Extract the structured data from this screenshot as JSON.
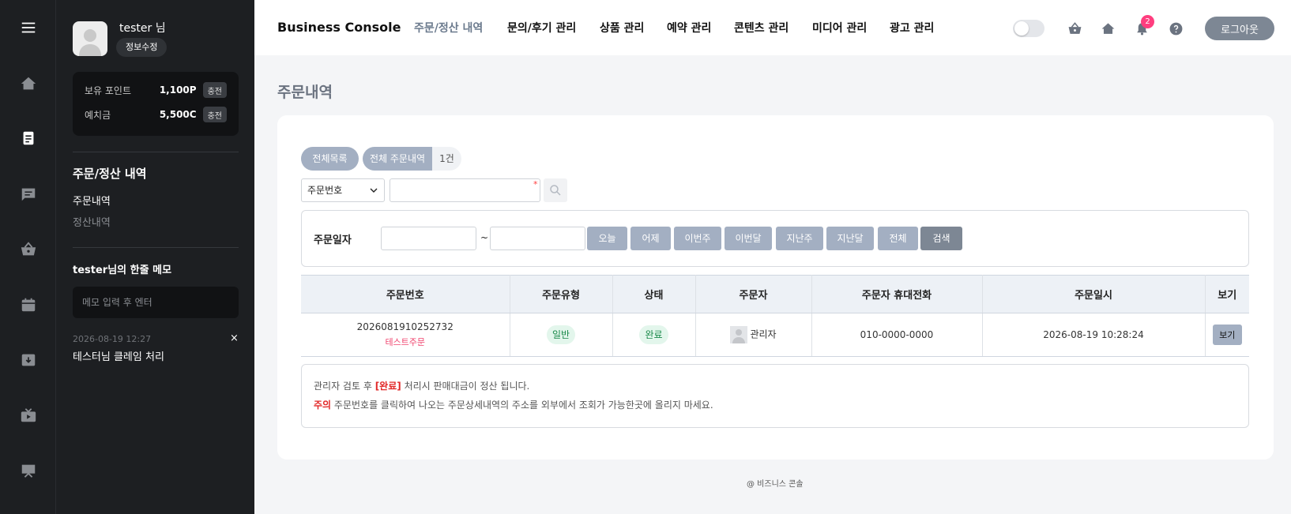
{
  "rail": {
    "items": [
      "menu-icon",
      "home-icon",
      "document-icon",
      "chat-icon",
      "basket-icon",
      "calendar-icon",
      "archive-icon",
      "tv-icon",
      "board-icon"
    ]
  },
  "profile": {
    "name": "tester 님",
    "edit_label": "정보수정"
  },
  "wallet": {
    "points_label": "보유 포인트",
    "points_value": "1,100P",
    "deposit_label": "예치금",
    "deposit_value": "5,500C",
    "charge_label": "충전"
  },
  "side_menu": {
    "title": "주문/정산 내역",
    "items": [
      {
        "label": "주문내역",
        "active": true
      },
      {
        "label": "정산내역",
        "active": false
      }
    ]
  },
  "memo": {
    "title": "tester님의 한줄 메모",
    "placeholder": "메모 입력 후 엔터",
    "entries": [
      {
        "date": "2026-08-19 12:27",
        "text": "테스터님 클레임 처리",
        "close": "×"
      }
    ]
  },
  "header": {
    "brand": "Business Console",
    "nav": [
      {
        "label": "주문/정산 내역",
        "active": true
      },
      {
        "label": "문의/후기 관리",
        "active": false
      },
      {
        "label": "상품 관리",
        "active": false
      },
      {
        "label": "예약 관리",
        "active": false
      },
      {
        "label": "콘텐츠 관리",
        "active": false
      },
      {
        "label": "미디어 관리",
        "active": false
      },
      {
        "label": "광고 관리",
        "active": false
      }
    ],
    "notification_count": "2",
    "logout_label": "로그아웃"
  },
  "page": {
    "title": "주문내역",
    "tabs": {
      "all_list": "전체목록",
      "all_orders": "전체 주문내역",
      "count": "1건"
    },
    "search": {
      "select_value": "주문번호",
      "input_value": "",
      "required_mark": "*"
    },
    "date_filter": {
      "label": "주문일자",
      "tilde": "~",
      "buttons": [
        "오늘",
        "어제",
        "이번주",
        "이번달",
        "지난주",
        "지난달",
        "전체"
      ],
      "search_label": "검색"
    },
    "table": {
      "headers": [
        "주문번호",
        "주문유형",
        "상태",
        "주문자",
        "주문자 휴대전화",
        "주문일시",
        "보기"
      ],
      "rows": [
        {
          "order_no": "2026081910252732",
          "order_tag": "테스트주문",
          "type": "일반",
          "status": "완료",
          "orderer": "관리자",
          "phone": "010-0000-0000",
          "datetime": "2026-08-19 10:28:24",
          "view_label": "보기"
        }
      ]
    },
    "notice": {
      "line1_pre": "관리자 검토 후 ",
      "line1_em": "[완료]",
      "line1_post": " 처리시 판매대금이 정산 됩니다.",
      "line2_em": "주의",
      "line2_post": " 주문번호를 클릭하여 나오는 주문상세내역의 주소를 외부에서 조회가 가능한곳에 올리지 마세요."
    }
  },
  "footer": {
    "text": "@ 비즈니스 콘솔"
  },
  "colors": {
    "sidebar_bg": "#1d1f22",
    "accent_gray": "#7d8794",
    "button_blue_gray": "#a3afc2",
    "badge_pink": "#ff3e7f",
    "status_green": "#1b8a4b",
    "warning_red": "#e22828"
  }
}
